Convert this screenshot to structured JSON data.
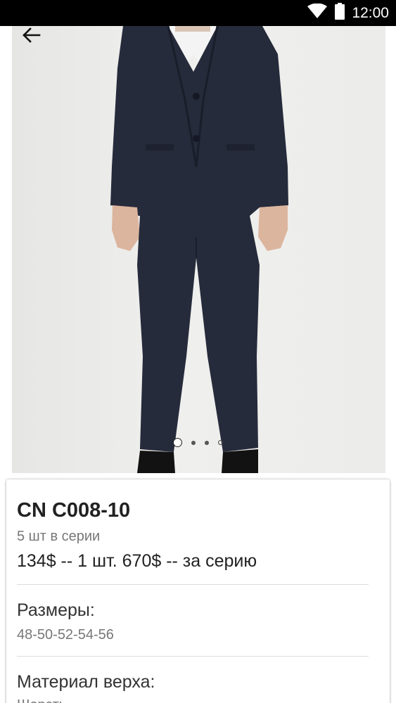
{
  "status_bar": {
    "time": "12:00",
    "icons": [
      "wifi-icon",
      "battery-icon"
    ]
  },
  "gallery": {
    "back_icon": "arrow-left-icon",
    "image_alt": "suit-photo",
    "page_count": 4,
    "active_page": 1
  },
  "product": {
    "name": "CN C008-10",
    "pack_info": "5 шт в серии",
    "price": "134$ -- 1 шт. 670$ -- за серию",
    "sizes_label": "Размеры:",
    "sizes_value": "48-50-52-54-56",
    "material_label": "Материал верха:",
    "material_value": "Шерсть"
  },
  "colors": {
    "status_bar_bg": "#000000",
    "suit": "#23283a",
    "photo_bg": "#ececea",
    "text_primary": "#222222",
    "text_secondary": "#777777"
  }
}
